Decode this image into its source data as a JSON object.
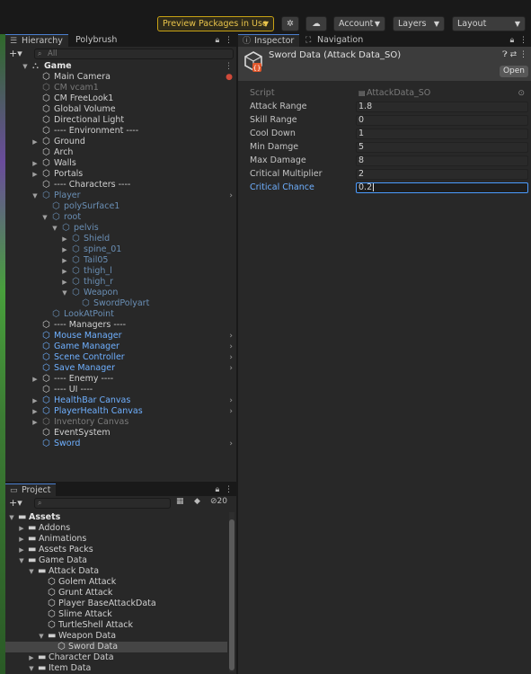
{
  "toolbar": {
    "preview_packages": "Preview Packages in Use",
    "account": "Account",
    "layers": "Layers",
    "layout": "Layout"
  },
  "hierarchy": {
    "tabs": [
      "Hierarchy",
      "Polybrush"
    ],
    "search_placeholder": "All",
    "rows": [
      {
        "label": "Game",
        "depth": 0,
        "arrow": "down",
        "style": "scene",
        "icon": "scene-icon"
      },
      {
        "label": "Main Camera",
        "depth": 1,
        "arrow": "",
        "style": "",
        "icon": "cube-icon"
      },
      {
        "label": "CM vcam1",
        "depth": 1,
        "arrow": "",
        "style": "inactive-plain",
        "icon": "cube-icon"
      },
      {
        "label": "CM FreeLook1",
        "depth": 1,
        "arrow": "",
        "style": "",
        "icon": "cube-icon"
      },
      {
        "label": "Global Volume",
        "depth": 1,
        "arrow": "",
        "style": "",
        "icon": "cube-icon"
      },
      {
        "label": "Directional Light",
        "depth": 1,
        "arrow": "",
        "style": "",
        "icon": "cube-icon"
      },
      {
        "label": "---- Environment ----",
        "depth": 1,
        "arrow": "",
        "style": "",
        "icon": "cube-icon"
      },
      {
        "label": "Ground",
        "depth": 1,
        "arrow": "right",
        "style": "",
        "icon": "cube-icon"
      },
      {
        "label": "Arch",
        "depth": 1,
        "arrow": "",
        "style": "",
        "icon": "cube-icon"
      },
      {
        "label": "Walls",
        "depth": 1,
        "arrow": "right",
        "style": "",
        "icon": "cube-icon"
      },
      {
        "label": "Portals",
        "depth": 1,
        "arrow": "right",
        "style": "",
        "icon": "cube-icon"
      },
      {
        "label": "---- Characters ----",
        "depth": 1,
        "arrow": "",
        "style": "",
        "icon": "cube-icon"
      },
      {
        "label": "Player",
        "depth": 1,
        "arrow": "down",
        "style": "inactive",
        "icon": "prefab-icon",
        "chev": true
      },
      {
        "label": "polySurface1",
        "depth": 2,
        "arrow": "",
        "style": "inactive",
        "icon": "cube-icon"
      },
      {
        "label": "root",
        "depth": 2,
        "arrow": "down",
        "style": "inactive",
        "icon": "cube-icon"
      },
      {
        "label": "pelvis",
        "depth": 3,
        "arrow": "down",
        "style": "inactive",
        "icon": "cube-icon"
      },
      {
        "label": "Shield",
        "depth": 4,
        "arrow": "right",
        "style": "inactive",
        "icon": "cube-icon"
      },
      {
        "label": "spine_01",
        "depth": 4,
        "arrow": "right",
        "style": "inactive",
        "icon": "cube-icon"
      },
      {
        "label": "Tail05",
        "depth": 4,
        "arrow": "right",
        "style": "inactive",
        "icon": "cube-icon"
      },
      {
        "label": "thigh_l",
        "depth": 4,
        "arrow": "right",
        "style": "inactive",
        "icon": "cube-icon"
      },
      {
        "label": "thigh_r",
        "depth": 4,
        "arrow": "right",
        "style": "inactive",
        "icon": "cube-icon"
      },
      {
        "label": "Weapon",
        "depth": 4,
        "arrow": "down",
        "style": "inactive",
        "icon": "cube-icon"
      },
      {
        "label": "SwordPolyart",
        "depth": 5,
        "arrow": "",
        "style": "inactive",
        "icon": "prefab-icon"
      },
      {
        "label": "LookAtPoint",
        "depth": 2,
        "arrow": "",
        "style": "inactive",
        "icon": "cube-icon"
      },
      {
        "label": "---- Managers ----",
        "depth": 1,
        "arrow": "",
        "style": "",
        "icon": "cube-icon"
      },
      {
        "label": "Mouse Manager",
        "depth": 1,
        "arrow": "",
        "style": "prefab",
        "icon": "prefab-icon",
        "chev": true
      },
      {
        "label": "Game Manager",
        "depth": 1,
        "arrow": "",
        "style": "prefab",
        "icon": "prefab-icon",
        "chev": true
      },
      {
        "label": "Scene Controller",
        "depth": 1,
        "arrow": "",
        "style": "prefab",
        "icon": "prefab-icon",
        "chev": true
      },
      {
        "label": "Save Manager",
        "depth": 1,
        "arrow": "",
        "style": "prefab",
        "icon": "prefab-icon",
        "chev": true
      },
      {
        "label": "---- Enemy ----",
        "depth": 1,
        "arrow": "right",
        "style": "",
        "icon": "cube-icon"
      },
      {
        "label": "---- UI ----",
        "depth": 1,
        "arrow": "",
        "style": "",
        "icon": "cube-icon"
      },
      {
        "label": "HealthBar Canvas",
        "depth": 1,
        "arrow": "right",
        "style": "prefab",
        "icon": "prefab-icon",
        "chev": true
      },
      {
        "label": "PlayerHealth Canvas",
        "depth": 1,
        "arrow": "right",
        "style": "prefab",
        "icon": "prefab-icon",
        "chev": true
      },
      {
        "label": "Inventory Canvas",
        "depth": 1,
        "arrow": "right",
        "style": "inactive-plain",
        "icon": "cube-icon"
      },
      {
        "label": "EventSystem",
        "depth": 1,
        "arrow": "",
        "style": "",
        "icon": "cube-icon"
      },
      {
        "label": "Sword",
        "depth": 1,
        "arrow": "",
        "style": "prefab",
        "icon": "prefab-icon",
        "chev": true
      }
    ]
  },
  "project": {
    "tab": "Project",
    "hidden_count": "20",
    "rows": [
      {
        "label": "Assets",
        "depth": 0,
        "arrow": "down",
        "icon": "folder-open-icon",
        "bold": true
      },
      {
        "label": "Addons",
        "depth": 1,
        "arrow": "right",
        "icon": "folder-icon"
      },
      {
        "label": "Animations",
        "depth": 1,
        "arrow": "right",
        "icon": "folder-icon"
      },
      {
        "label": "Assets Packs",
        "depth": 1,
        "arrow": "right",
        "icon": "folder-icon"
      },
      {
        "label": "Game Data",
        "depth": 1,
        "arrow": "down",
        "icon": "folder-open-icon"
      },
      {
        "label": "Attack Data",
        "depth": 2,
        "arrow": "down",
        "icon": "folder-open-icon"
      },
      {
        "label": "Golem Attack",
        "depth": 3,
        "arrow": "",
        "icon": "so-asset-icon"
      },
      {
        "label": "Grunt Attack",
        "depth": 3,
        "arrow": "",
        "icon": "so-asset-icon"
      },
      {
        "label": "Player BaseAttackData",
        "depth": 3,
        "arrow": "",
        "icon": "so-asset-icon"
      },
      {
        "label": "Slime Attack",
        "depth": 3,
        "arrow": "",
        "icon": "so-asset-icon"
      },
      {
        "label": "TurtleShell Attack",
        "depth": 3,
        "arrow": "",
        "icon": "so-asset-icon"
      },
      {
        "label": "Weapon Data",
        "depth": 3,
        "arrow": "down",
        "icon": "folder-open-icon"
      },
      {
        "label": "Sword Data",
        "depth": 4,
        "arrow": "",
        "icon": "so-asset-icon",
        "sel": true
      },
      {
        "label": "Character Data",
        "depth": 2,
        "arrow": "right",
        "icon": "folder-icon"
      },
      {
        "label": "Item Data",
        "depth": 2,
        "arrow": "down",
        "icon": "folder-open-icon"
      }
    ]
  },
  "inspector": {
    "tabs": [
      "Inspector",
      "Navigation"
    ],
    "title": "Sword Data (Attack Data_SO)",
    "open_label": "Open",
    "fields": [
      {
        "label": "Script",
        "value": "AttackData_SO",
        "state": "disabled"
      },
      {
        "label": "Attack Range",
        "value": "1.8",
        "state": ""
      },
      {
        "label": "Skill Range",
        "value": "0",
        "state": ""
      },
      {
        "label": "Cool Down",
        "value": "1",
        "state": ""
      },
      {
        "label": "Min Damge",
        "value": "5",
        "state": ""
      },
      {
        "label": "Max Damage",
        "value": "8",
        "state": ""
      },
      {
        "label": "Critical Multiplier",
        "value": "2",
        "state": ""
      },
      {
        "label": "Critical Chance",
        "value": "0.2",
        "state": "focus"
      }
    ]
  },
  "colors": {
    "accent": "#4b9cff",
    "prefab_text": "#6fb0ff",
    "preview_border": "#c8a214"
  }
}
